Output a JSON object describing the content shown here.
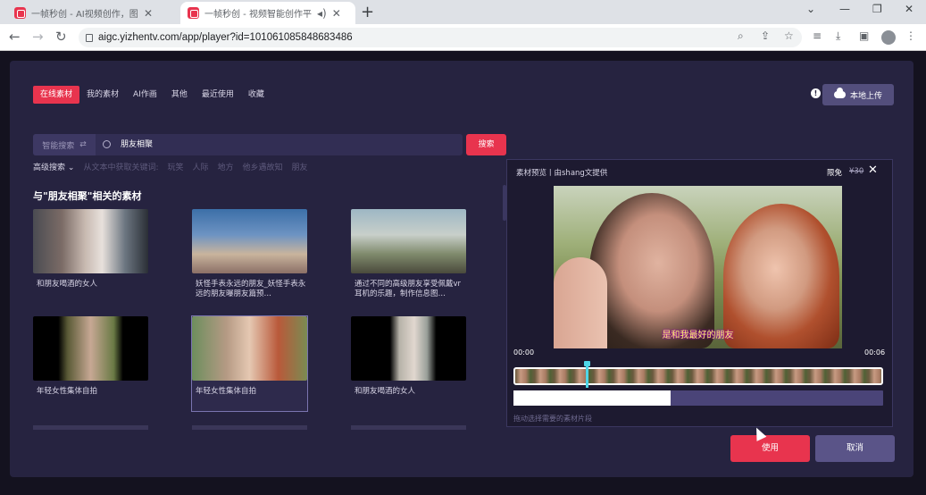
{
  "browser": {
    "tabs": [
      {
        "title": "一帧秒创 - AI视频创作，图文转",
        "active": false
      },
      {
        "title": "一帧秒创 - 视频智能创作平台",
        "active": true
      }
    ],
    "url": "aigc.yizhentv.com/app/player?id=101061085848683486"
  },
  "tabs": [
    "在线素材",
    "我的素材",
    "AI作画",
    "其他",
    "最近使用",
    "收藏"
  ],
  "active_tab": "在线素材",
  "upload_label": "本地上传",
  "search": {
    "mode_label": "智能搜索",
    "value": "朋友相聚",
    "button": "搜索"
  },
  "advanced": {
    "label": "高级搜索",
    "hint": "从文本中获取关键词:",
    "suggestions": [
      "玩笑",
      "人际",
      "地方",
      "他乡遇故知",
      "朋友"
    ]
  },
  "section_title": "与\"朋友相聚\"相关的素材",
  "cards": [
    {
      "caption": "和朋友喝酒的女人"
    },
    {
      "caption": "妖怪手表永远的朋友_妖怪手表永远的朋友曝朋友篇预…"
    },
    {
      "caption": "通过不同的高级朋友享受佩戴vr耳机的乐趣，制作信息图…"
    },
    {
      "caption": "年轻女性集体自拍"
    },
    {
      "caption": "年轻女性集体自拍"
    },
    {
      "caption": "和朋友喝酒的女人"
    }
  ],
  "preview": {
    "header": "素材预览丨由shang文提供",
    "limit_label": "限免",
    "price": "¥30",
    "subtitle": "是和我最好的朋友",
    "time_start": "00:00",
    "time_end": "00:06",
    "range_hint": "拖动选择需要的素材片段",
    "selected_fraction": 0.425
  },
  "buttons": {
    "use": "使用",
    "cancel": "取消"
  },
  "colors": {
    "accent": "#e8344e",
    "panel": "#262340",
    "secondary": "#5a5488"
  }
}
